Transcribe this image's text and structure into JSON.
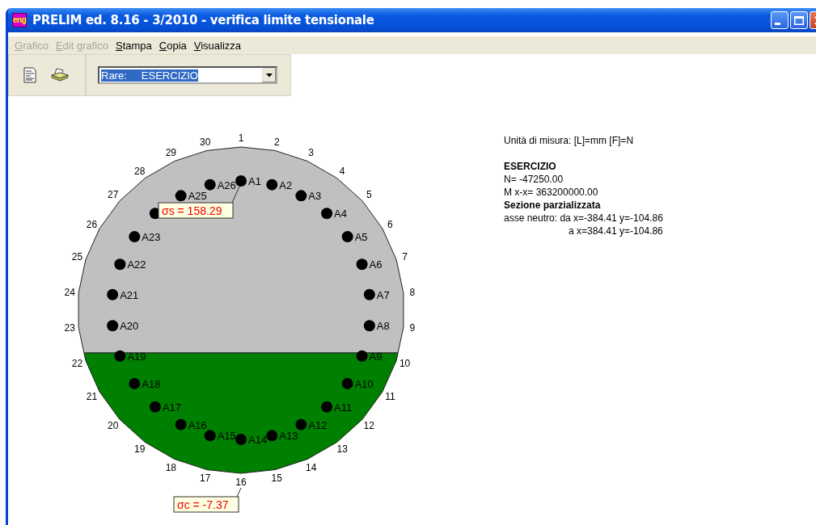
{
  "window": {
    "app_icon": "eng",
    "title": "PRELIM ed. 8.16 - 3/2010 - verifica limite tensionale"
  },
  "menu": [
    {
      "label": "Grafico",
      "disabled": true
    },
    {
      "label": "Edit grafico",
      "disabled": true
    },
    {
      "label": "Stampa",
      "disabled": false
    },
    {
      "label": "Copia",
      "disabled": false
    },
    {
      "label": "Visualizza",
      "disabled": false
    }
  ],
  "combo": {
    "value": "Rare:     ESERCIZIO"
  },
  "section": {
    "vertices": [
      "1",
      "2",
      "3",
      "4",
      "5",
      "6",
      "7",
      "8",
      "9",
      "10",
      "11",
      "12",
      "13",
      "14",
      "15",
      "16",
      "17",
      "18",
      "19",
      "20",
      "21",
      "22",
      "23",
      "24",
      "25",
      "26",
      "27",
      "28",
      "29",
      "30"
    ],
    "bars": [
      {
        "kind": "labelled",
        "label": "A1"
      },
      {
        "kind": "labelled",
        "label": "A2"
      },
      {
        "kind": "labelled",
        "label": "A3"
      },
      {
        "kind": "labelled",
        "label": "A4"
      },
      {
        "kind": "labelled",
        "label": "A5"
      },
      {
        "kind": "labelled",
        "label": "A6"
      },
      {
        "kind": "labelled",
        "label": "A7"
      },
      {
        "kind": "labelled",
        "label": "A8"
      },
      {
        "kind": "labelled",
        "label": "A9"
      },
      {
        "kind": "labelled",
        "label": "A10"
      },
      {
        "kind": "labelled",
        "label": "A11"
      },
      {
        "kind": "labelled",
        "label": "A12"
      },
      {
        "kind": "labelled",
        "label": "A13"
      },
      {
        "kind": "labelled",
        "label": "A14"
      },
      {
        "kind": "labelled",
        "label": "A15"
      },
      {
        "kind": "labelled",
        "label": "A16"
      },
      {
        "kind": "labelled",
        "label": "A17"
      },
      {
        "kind": "labelled",
        "label": "A18"
      },
      {
        "kind": "labelled",
        "label": "A19"
      },
      {
        "kind": "labelled",
        "label": "A20"
      },
      {
        "kind": "labelled",
        "label": "A21"
      },
      {
        "kind": "labelled",
        "label": "A22"
      },
      {
        "kind": "labelled",
        "label": "A23"
      },
      {
        "kind": "unlabelled"
      },
      {
        "kind": "labelled",
        "label": "A25"
      },
      {
        "kind": "labelled",
        "label": "A26"
      }
    ],
    "steel_stress": "σs = 158.29",
    "concrete_stress": "σc = -7.37"
  },
  "info": [
    {
      "kind": "normal",
      "text": "Unità di misura: [L]=mm  [F]=N"
    },
    {
      "kind": "gap"
    },
    {
      "kind": "bold",
      "text": "ESERCIZIO"
    },
    {
      "kind": "normal",
      "text": "N= -47250.00"
    },
    {
      "kind": "normal",
      "text": "M x-x= 363200000.00"
    },
    {
      "kind": "bold",
      "text": "Sezione parzializzata"
    },
    {
      "kind": "normal",
      "text": "asse neutro: da x=-384.41 y=-104.86"
    },
    {
      "kind": "indent",
      "text": "a x=384.41 y=-104.86"
    }
  ]
}
